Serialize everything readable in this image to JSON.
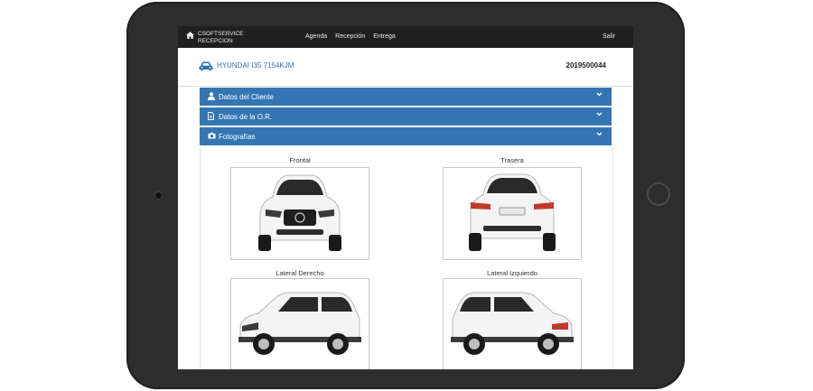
{
  "app": {
    "brand_line1": "CSOFTSERVICE",
    "brand_line2": "RECEPCION",
    "nav": [
      "Agenda",
      "Recepción",
      "Entrega"
    ],
    "logout": "Salir"
  },
  "vehicle": {
    "plate": "HYUNDAI I35 7154KJM",
    "order_number": "2019500044"
  },
  "panels": [
    {
      "label": "Datos del Cliente",
      "icon": "user-icon"
    },
    {
      "label": "Datos de la O.R.",
      "icon": "document-icon"
    },
    {
      "label": "Fotografías",
      "icon": "camera-icon"
    }
  ],
  "photos": {
    "front": "Frontal",
    "rear": "Trasera",
    "right": "Lateral Derecho",
    "left": "Lateral Izquierdo"
  },
  "colors": {
    "accent": "#3675b4",
    "topbar": "#1f1f1f",
    "bezel": "#2e2e2e"
  }
}
